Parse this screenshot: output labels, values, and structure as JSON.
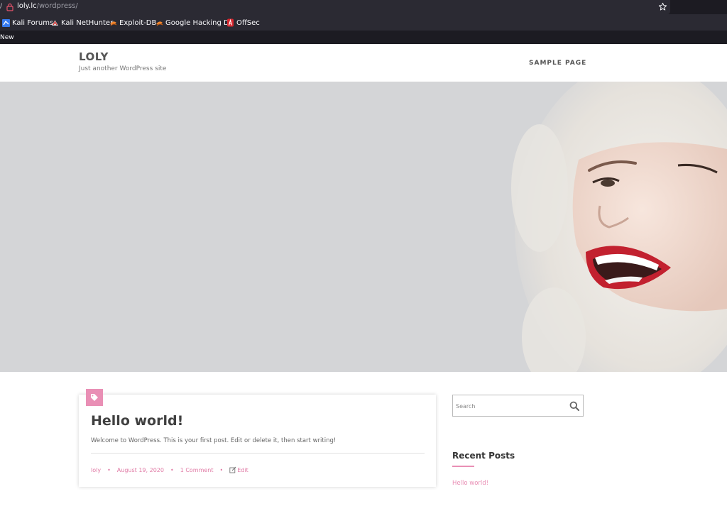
{
  "browser": {
    "url_host": "loly.lc",
    "url_path": "/wordpress/",
    "bookmarks": [
      {
        "label": "Kali Forums",
        "icon": "kali-forums-icon"
      },
      {
        "label": "Kali NetHunter",
        "icon": "nethunter-icon"
      },
      {
        "label": "Exploit-DB",
        "icon": "exploit-db-icon"
      },
      {
        "label": "Google Hacking DB",
        "icon": "ghdb-icon"
      },
      {
        "label": "OffSec",
        "icon": "offsec-icon"
      }
    ],
    "tab_label": "New"
  },
  "site": {
    "title": "LOLY",
    "tagline": "Just another WordPress site",
    "nav": {
      "sample_page": "SAMPLE PAGE"
    }
  },
  "post": {
    "title": "Hello world!",
    "excerpt": "Welcome to WordPress. This is your first post. Edit or delete it, then start writing!",
    "meta": {
      "author": "loly",
      "date": "August 19, 2020",
      "comments": "1 Comment",
      "edit": "Edit"
    }
  },
  "sidebar": {
    "search_placeholder": "Search",
    "recent_posts_title": "Recent Posts",
    "recent_posts": [
      "Hello world!"
    ]
  },
  "colors": {
    "accent": "#e98fb5",
    "hero_background": "#d4d5d7",
    "browser_chrome": "#2b2a33"
  }
}
